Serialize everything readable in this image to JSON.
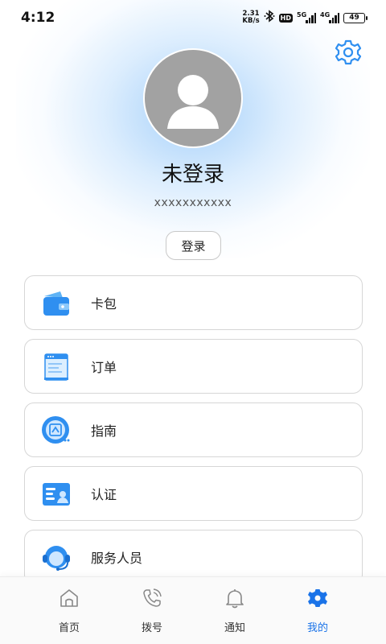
{
  "status_bar": {
    "time": "4:12",
    "net_speed_value": "2.31",
    "net_speed_unit": "KB/s",
    "hd_badge": "HD",
    "sim1_label": "5G",
    "sim2_label": "4G",
    "battery": "49",
    "icons": [
      "bluetooth-icon",
      "signal-icon",
      "battery-icon"
    ]
  },
  "profile": {
    "name": "未登录",
    "account": "xxxxxxxxxxx",
    "login_label": "登录",
    "avatar_icon": "default-avatar-icon"
  },
  "menu": [
    {
      "label": "卡包",
      "icon": "wallet-icon"
    },
    {
      "label": "订单",
      "icon": "order-document-icon"
    },
    {
      "label": "指南",
      "icon": "guide-icon"
    },
    {
      "label": "认证",
      "icon": "id-card-icon"
    },
    {
      "label": "服务人员",
      "icon": "customer-service-icon"
    }
  ],
  "tabs": [
    {
      "label": "首页",
      "icon": "home-icon",
      "active": false
    },
    {
      "label": "拨号",
      "icon": "phone-icon",
      "active": false
    },
    {
      "label": "通知",
      "icon": "bell-icon",
      "active": false
    },
    {
      "label": "我的",
      "icon": "profile-gear-icon",
      "active": true
    }
  ],
  "colors": {
    "accent": "#1a73e8",
    "icon_blue": "#2f8ff0",
    "avatar_gray": "#a2a2a2"
  }
}
